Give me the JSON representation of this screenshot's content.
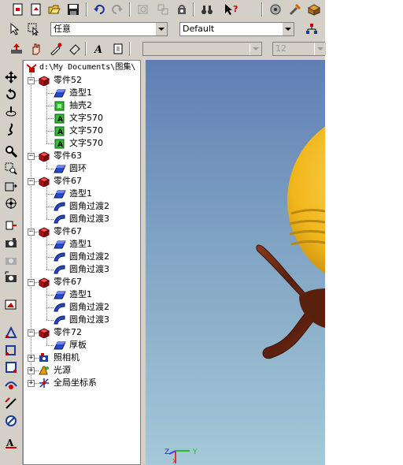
{
  "colors": {
    "chrome": "#d4d0c8",
    "sky_top": "#5f7fb4",
    "sky_bottom": "#a5c9d8",
    "sphere": "#f0b61c",
    "wood": "#6b2a16"
  },
  "toolbar_top": {
    "icons": [
      "new-doc-icon",
      "open-doc-icon",
      "open-folder-icon",
      "save-icon",
      "undo-icon",
      "redo-icon",
      "tool-a-icon",
      "tool-b-icon",
      "tool-c-icon",
      "binoculars-icon",
      "help-cursor-icon",
      "engine-icon",
      "tools-icon",
      "package-icon"
    ]
  },
  "toolbar_second": {
    "filter_value": "任意",
    "style_value": "Default"
  },
  "toolbar_third": {
    "font_value": "",
    "size_value": "12"
  },
  "tree": {
    "root_label": "d:\\My Documents\\图集\\",
    "nodes": [
      {
        "label": "零件52",
        "type": "part"
      },
      {
        "label": "造型1",
        "type": "shape"
      },
      {
        "label": "抽壳2",
        "type": "shell"
      },
      {
        "label": "文字570",
        "type": "text"
      },
      {
        "label": "文字570",
        "type": "text"
      },
      {
        "label": "文字570",
        "type": "text"
      },
      {
        "label": "零件63",
        "type": "part"
      },
      {
        "label": "圆环",
        "type": "shape"
      },
      {
        "label": "零件67",
        "type": "part"
      },
      {
        "label": "造型1",
        "type": "shape"
      },
      {
        "label": "圆角过渡2",
        "type": "fillet"
      },
      {
        "label": "圆角过渡3",
        "type": "fillet"
      },
      {
        "label": "零件67",
        "type": "part"
      },
      {
        "label": "造型1",
        "type": "shape"
      },
      {
        "label": "圆角过渡2",
        "type": "fillet"
      },
      {
        "label": "圆角过渡3",
        "type": "fillet"
      },
      {
        "label": "零件67",
        "type": "part"
      },
      {
        "label": "造型1",
        "type": "shape"
      },
      {
        "label": "圆角过渡2",
        "type": "fillet"
      },
      {
        "label": "圆角过渡3",
        "type": "fillet"
      },
      {
        "label": "零件72",
        "type": "part"
      },
      {
        "label": "厚板",
        "type": "shape"
      },
      {
        "label": "照相机",
        "type": "camera"
      },
      {
        "label": "光源",
        "type": "light"
      },
      {
        "label": "全局坐标系",
        "type": "axes"
      }
    ]
  },
  "viewport": {
    "axis_labels": {
      "z": "Z",
      "y": "Y",
      "x": "X"
    }
  }
}
